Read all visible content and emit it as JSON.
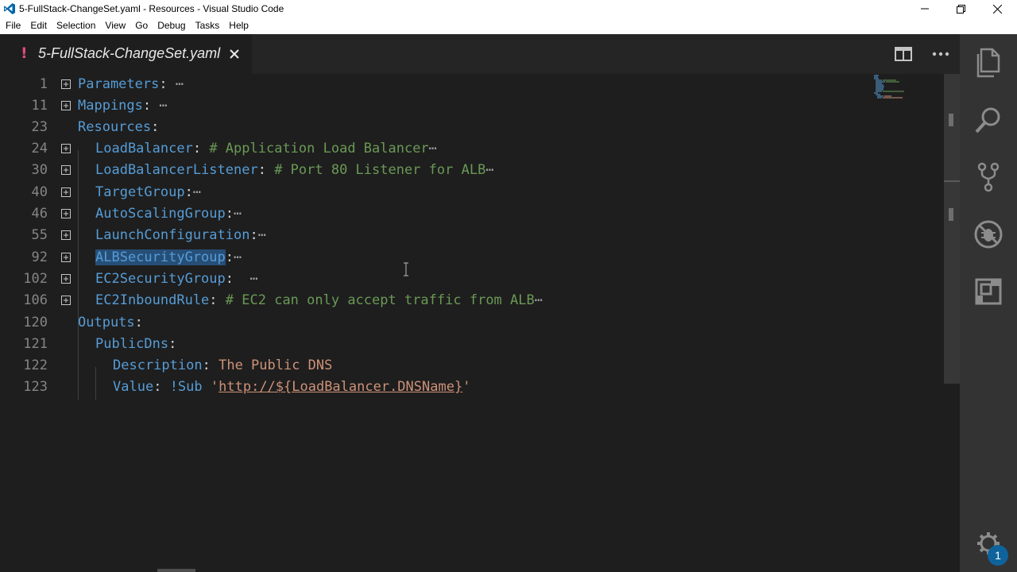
{
  "window": {
    "title": "5-FullStack-ChangeSet.yaml - Resources - Visual Studio Code",
    "app_icon": "vscode-logo-icon",
    "controls": [
      "minimize-icon",
      "restore-icon",
      "close-icon"
    ]
  },
  "menu": {
    "items": [
      "File",
      "Edit",
      "Selection",
      "View",
      "Go",
      "Debug",
      "Tasks",
      "Help"
    ]
  },
  "tab": {
    "modified_marker": "!",
    "label": "5-FullStack-ChangeSet.yaml",
    "close_icon": "close-icon"
  },
  "tab_actions": [
    "split-editor-icon",
    "more-actions-icon"
  ],
  "editor": {
    "lines": [
      {
        "n": "1"
      },
      {
        "n": "11"
      },
      {
        "n": "23"
      },
      {
        "n": "24"
      },
      {
        "n": "30"
      },
      {
        "n": "40"
      },
      {
        "n": "46"
      },
      {
        "n": "55"
      },
      {
        "n": "92"
      },
      {
        "n": "102"
      },
      {
        "n": "106"
      },
      {
        "n": "120"
      },
      {
        "n": "121"
      },
      {
        "n": "122"
      },
      {
        "n": "123"
      }
    ],
    "code": {
      "l1_key": "Parameters",
      "l1_rest": ":",
      "l11_key": "Mappings",
      "l11_rest": ":",
      "l23_key": "Resources",
      "l23_rest": ":",
      "l24_key": "LoadBalancer",
      "l24_colon": ":",
      "l24_comment": "# Application Load Balancer",
      "l30_key": "LoadBalancerListener",
      "l30_colon": ":",
      "l30_comment": "# Port 80 Listener for ALB",
      "l40_key": "TargetGroup",
      "l40_rest": ":",
      "l46_key": "AutoScalingGroup",
      "l46_rest": ":",
      "l55_key": "LaunchConfiguration",
      "l55_rest": ":",
      "l92_key": "ALBSecurityGroup",
      "l92_rest": ":",
      "l102_key": "EC2SecurityGroup",
      "l102_rest": ":",
      "l106_key": "EC2InboundRule",
      "l106_colon": ":",
      "l106_comment": "# EC2 can only accept traffic from ALB",
      "l120_key": "Outputs",
      "l120_rest": ":",
      "l121_key": "PublicDns",
      "l121_rest": ":",
      "l122_key": "Description",
      "l122_colon": ":",
      "l122_value": "The Public DNS",
      "l123_key": "Value",
      "l123_colon": ":",
      "l123_tag": "!Sub",
      "l123_q1": "'",
      "l123_url": "http://${LoadBalancer.DNSName}",
      "l123_q2": "'"
    },
    "fold_ellipsis": "⋯",
    "selected_text": "ALBSecurityGroup"
  },
  "activity_bar": [
    "explorer-icon",
    "search-icon",
    "source-control-icon",
    "debug-icon",
    "extensions-icon",
    "settings-gear-icon"
  ],
  "settings_badge": "1",
  "colors": {
    "background": "#1e1e1e",
    "key": "#569cd6",
    "comment": "#6a9955",
    "string": "#ce9178",
    "selection": "#264f78",
    "activity_bar": "#333333"
  }
}
